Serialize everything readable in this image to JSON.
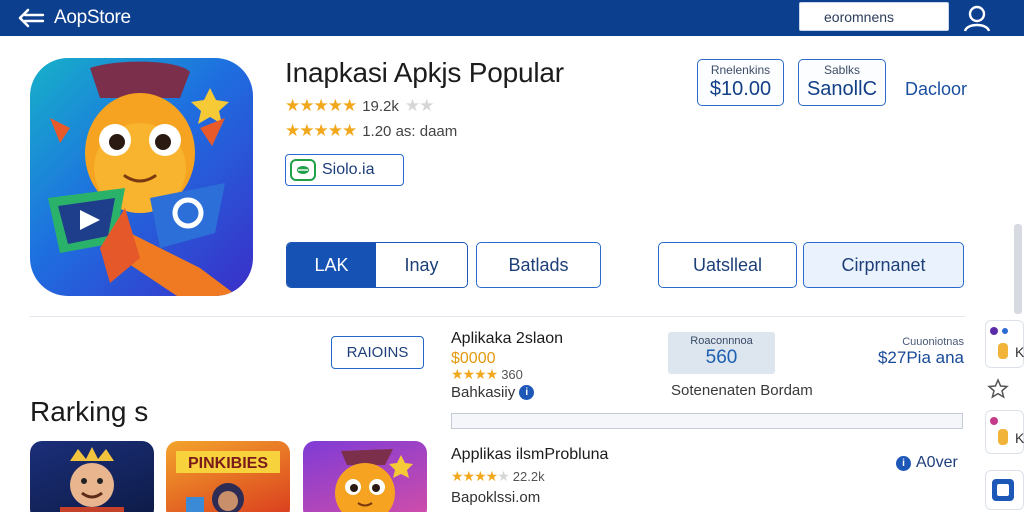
{
  "header": {
    "app_title": "AopStore",
    "search_placeholder": "eoromnens"
  },
  "hero": {
    "title": "Inapkasi Apkjs Popular",
    "rating_primary": "19.2k",
    "rating_secondary": "1.20 as: daam",
    "badge_label": "Siolo.ia"
  },
  "price_cards": [
    {
      "small": "Rnelenkins",
      "big": "$10.00"
    },
    {
      "small": "Sablks",
      "big": "SanollC"
    }
  ],
  "decline_label": "Dacloor",
  "buttons": {
    "seg_active": "LAK",
    "seg_inactive": "Inay",
    "details": "Batlads",
    "install": "Uatslleal",
    "component": "Cirprnanet"
  },
  "section": {
    "tag": "RAIOINS",
    "title": "Rarking s"
  },
  "list": [
    {
      "title": "Aplikaka 2slaon",
      "price": "$0000",
      "rating": "360",
      "sub": "Bahkasiiy"
    },
    {
      "title": "Applikas ilsmProbluna",
      "rating": "22.2k",
      "sub": "Bapoklssi.om"
    }
  ],
  "score": {
    "label": "Roaconnnoa",
    "value": "560"
  },
  "stat_text": "Sotenenaten Bordam",
  "side_price": {
    "label": "Cuuoniotnas",
    "value": "$27Pia ana"
  },
  "aover_label": "A0ver",
  "progress": 0.0,
  "rail": {
    "k1": "K",
    "k2": "K"
  },
  "colors": {
    "topbar": "#0d3f8f",
    "accent": "#1652b3",
    "star": "#f2a81d"
  }
}
